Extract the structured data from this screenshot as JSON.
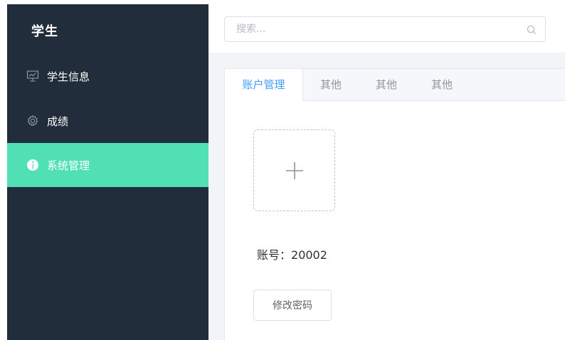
{
  "sidebar": {
    "brand": "学生",
    "items": [
      {
        "label": "学生信息",
        "icon": "presentation-chart-icon",
        "active": false
      },
      {
        "label": "成绩",
        "icon": "gear-icon",
        "active": false
      },
      {
        "label": "系统管理",
        "icon": "info-icon",
        "active": true
      }
    ],
    "bg_color": "#222d3c",
    "active_color": "#50e0b4"
  },
  "search": {
    "placeholder": "搜索...",
    "value": "",
    "icon": "search-icon"
  },
  "tabs": [
    {
      "label": "账户管理",
      "active": true
    },
    {
      "label": "其他",
      "active": false
    },
    {
      "label": "其他",
      "active": false
    },
    {
      "label": "其他",
      "active": false
    }
  ],
  "account": {
    "upload_icon": "plus-icon",
    "account_prefix": "账号：",
    "account_number": "20002",
    "change_password_label": "修改密码"
  },
  "colors": {
    "tab_active": "#409eff"
  }
}
